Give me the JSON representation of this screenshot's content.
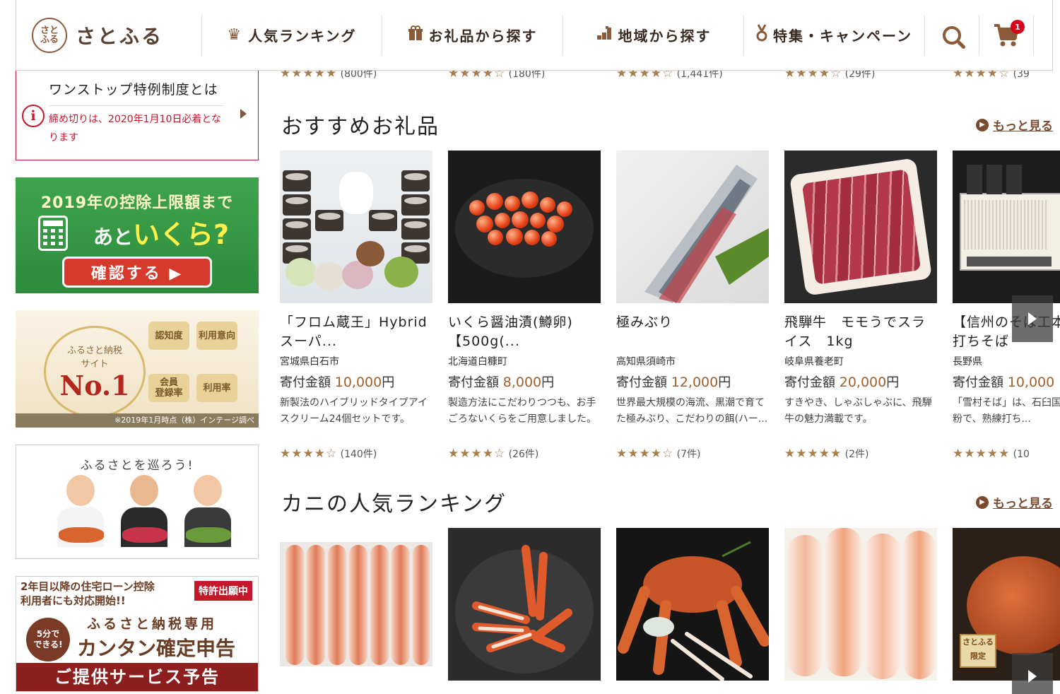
{
  "header": {
    "logo_mark": "さと\nふる",
    "logo_text": "さとふる",
    "nav": [
      {
        "label": "人気ランキング",
        "icon": "crown-icon",
        "glyph": "♛"
      },
      {
        "label": "お礼品から探す",
        "icon": "gift-icon",
        "glyph": "🎁"
      },
      {
        "label": "地域から探す",
        "icon": "map-icon",
        "glyph": "▟"
      },
      {
        "label": "特集・キャンペーン",
        "icon": "medal-icon",
        "glyph": "♉"
      }
    ],
    "cart_count": "1"
  },
  "sidebar": {
    "notice": {
      "title": "ワンストップ特例制度とは",
      "body": "締め切りは、2020年1月10日必着となります",
      "info_glyph": "i"
    },
    "banner_calc": {
      "top": "2019年の控除上限額まで",
      "mid_prefix": "あと",
      "mid_emph": "いくら?",
      "button": "確認する ▶"
    },
    "banner_no1": {
      "site": "ふるさと納税\nサイト",
      "rank": "No.1",
      "medals": [
        "認知度",
        "利用意向",
        "会員\n登録率",
        "利用率"
      ],
      "footnote": "※2019年1月時点（株）インテージ調べ"
    },
    "banner_tour": {
      "title": "ふるさとを巡ろう!"
    },
    "banner_loan": {
      "line1": "2年目以降の住宅ローン控除",
      "line1b": "利用者にも対応開始!!",
      "badge": "特許出願中",
      "circle": "5分で\nできる!",
      "line2": "ふるさと納税専用",
      "line3": "カンタン確定申告",
      "footer": "ご提供サービス予告"
    }
  },
  "prev_row": [
    {
      "stars": "★★★★★",
      "count": "(800件)"
    },
    {
      "stars": "★★★★☆",
      "count": "(180件)"
    },
    {
      "stars": "★★★★☆",
      "count": "(1,441件)"
    },
    {
      "stars": "★★★★☆",
      "count": "(29件)"
    },
    {
      "stars": "★★★★☆",
      "count": "(39"
    }
  ],
  "recommended": {
    "heading": "おすすめお礼品",
    "more": "もっと見る",
    "items": [
      {
        "title": "「フロム蔵王」Hybrid　スーパ...",
        "region": "宮城県白石市",
        "price_label": "寄付金額 ",
        "price": "10,000",
        "unit": "円",
        "desc": "新製法のハイブリッドタイプアイスクリーム24個セットです。",
        "stars": "★★★★☆",
        "count": "(140件)"
      },
      {
        "title": "いくら醤油漬(鱒卵)　【500g(...",
        "region": "北海道白糠町",
        "price_label": "寄付金額 ",
        "price": "8,000",
        "unit": "円",
        "desc": "製造方法にこだわりつつも、お手ごろないくらをご用意しました。",
        "stars": "★★★★☆",
        "count": "(26件)"
      },
      {
        "title": "極みぶり",
        "region": "高知県須崎市",
        "price_label": "寄付金額 ",
        "price": "12,000",
        "unit": "円",
        "desc": "世界最大規模の海流、黒潮で育てた極みぶり、こだわりの餌(ハー...",
        "stars": "★★★★☆",
        "count": "(7件)"
      },
      {
        "title": "飛騨牛　モモうでスライス　1kg",
        "region": "岐阜県養老町",
        "price_label": "寄付金額 ",
        "price": "20,000",
        "unit": "円",
        "desc": "すきやき、しゃぶしゃぶに、飛騨牛の魅力満載です。",
        "stars": "★★★★★",
        "count": "(2件)"
      },
      {
        "title": "【信州のそば工本生手打ちそば",
        "region": "長野県",
        "price_label": "寄付金額 ",
        "price": "10,000",
        "unit": "",
        "desc": "「雪村そば」は、石臼国産のそば粉で、熟練打ち...",
        "stars": "★★★★★",
        "count": "(10"
      }
    ]
  },
  "crab": {
    "heading": "カニの人気ランキング",
    "more": "もっと見る",
    "gentei": "さとふる\n限定"
  },
  "colors": {
    "brand": "#8a5a3a",
    "accent_red": "#c4182b",
    "price": "#a0602e"
  }
}
